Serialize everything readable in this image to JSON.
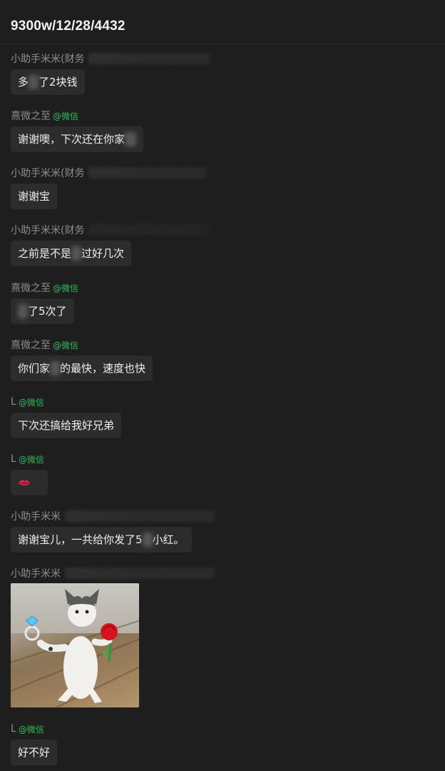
{
  "header": {
    "title": "9300w/12/28/4432"
  },
  "colors": {
    "background": "#1e1e1e",
    "bubble": "#2c2c2c",
    "sender": "#8e8e8e",
    "wechat_tag": "#2fbd5a"
  },
  "messages": [
    {
      "sender": "小助手米米(财务",
      "tag": "",
      "text_a": "多",
      "text_b": "了2块钱",
      "type": "text"
    },
    {
      "sender": "熹微之至",
      "tag": "@微信",
      "text_a": "谢谢噢，下次还在你家",
      "text_b": "",
      "type": "text"
    },
    {
      "sender": "小助手米米(财务",
      "tag": "",
      "text_a": "谢谢宝",
      "text_b": "",
      "type": "text"
    },
    {
      "sender": "小助手米米(财务",
      "tag": "",
      "text_a": "之前是不是",
      "text_b": "过好几次",
      "type": "text"
    },
    {
      "sender": "熹微之至",
      "tag": "@微信",
      "text_a": "",
      "text_b": "了5次了",
      "type": "text"
    },
    {
      "sender": "熹微之至",
      "tag": "@微信",
      "text_a": "你们家",
      "text_b": "的最快，速度也快",
      "type": "text"
    },
    {
      "sender": "L",
      "tag": "@微信",
      "text_a": "下次还搞给我好兄弟",
      "text_b": "",
      "type": "text"
    },
    {
      "sender": "L",
      "tag": "@微信",
      "emoji": "lips-emoji",
      "type": "emoji"
    },
    {
      "sender": "小助手米米",
      "tag": "",
      "text_a": "谢谢宝儿，一共给你发了5",
      "text_b": "小红。",
      "type": "text"
    },
    {
      "sender": "小助手米米",
      "tag": "",
      "image": "cat-with-ring-and-rose-sticker",
      "type": "image"
    },
    {
      "sender": "L",
      "tag": "@微信",
      "text_a": "好不好",
      "text_b": "",
      "type": "text"
    }
  ]
}
